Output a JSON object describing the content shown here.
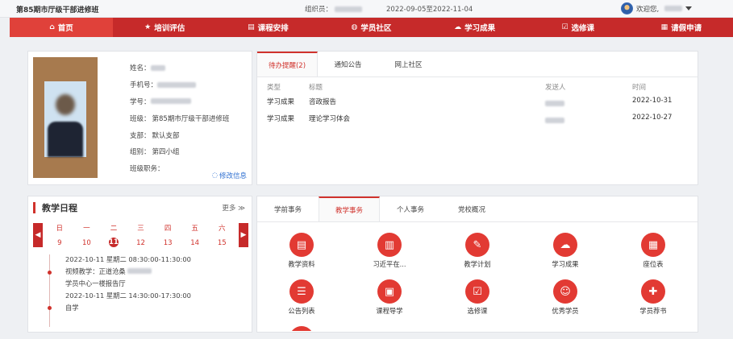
{
  "topbar": {
    "class_title": "第85期市厅级干部进修班",
    "organizer_label": "组织员：",
    "date_range": "2022-09-05至2022-11-04",
    "welcome_label": "欢迎您,"
  },
  "nav": {
    "items": [
      {
        "label": "首页",
        "icon": "home-icon",
        "glyph": "⌂"
      },
      {
        "label": "培训评估",
        "icon": "star-icon",
        "glyph": "★"
      },
      {
        "label": "课程安排",
        "icon": "schedule-icon",
        "glyph": "▤"
      },
      {
        "label": "学员社区",
        "icon": "globe-icon",
        "glyph": "◍"
      },
      {
        "label": "学习成果",
        "icon": "cloud-upload-icon",
        "glyph": "☁"
      },
      {
        "label": "选修课",
        "icon": "checkbox-icon",
        "glyph": "☑"
      },
      {
        "label": "请假申请",
        "icon": "document-icon",
        "glyph": "▦"
      }
    ]
  },
  "profile": {
    "name_label": "姓名：",
    "phone_label": "手机号：",
    "student_id_label": "学号：",
    "class_label": "班级：",
    "class_value": "第85期市厅级干部进修班",
    "branch_label": "支部：",
    "branch_value": "默认支部",
    "group_label": "组别：",
    "group_value": "第四小组",
    "duty_label": "班级职务：",
    "edit_label": "修改信息"
  },
  "todo": {
    "tabs": [
      "待办提醒(2)",
      "通知公告",
      "网上社区"
    ],
    "columns": [
      "类型",
      "标题",
      "发送人",
      "时间"
    ],
    "rows": [
      {
        "type": "学习成果",
        "title": "咨政报告",
        "time": "2022-10-31"
      },
      {
        "type": "学习成果",
        "title": "理论学习体会",
        "time": "2022-10-27"
      }
    ]
  },
  "schedule": {
    "title": "教学日程",
    "more_label": "更多 ≫",
    "days": [
      {
        "w": "日",
        "d": "9"
      },
      {
        "w": "一",
        "d": "10"
      },
      {
        "w": "二",
        "d": "11"
      },
      {
        "w": "三",
        "d": "12"
      },
      {
        "w": "四",
        "d": "13"
      },
      {
        "w": "五",
        "d": "14"
      },
      {
        "w": "六",
        "d": "15"
      }
    ],
    "events": [
      {
        "time": "2022-10-11 星期二 08:30:00-11:30:00",
        "title": "视频教学：正道沧桑",
        "place": "学员中心一楼报告厅"
      },
      {
        "time": "2022-10-11 星期二 14:30:00-17:30:00",
        "title": "自学"
      }
    ]
  },
  "affairs": {
    "tabs": [
      "学前事务",
      "教学事务",
      "个人事务",
      "党校概况"
    ],
    "items": [
      {
        "label": "教学资料",
        "icon": "teaching-materials-icon",
        "glyph": "▤"
      },
      {
        "label": "习近平在...",
        "icon": "scroll-icon",
        "glyph": "▥"
      },
      {
        "label": "教学计划",
        "icon": "plan-edit-icon",
        "glyph": "✎"
      },
      {
        "label": "学习成果",
        "icon": "cloud-upload-icon",
        "glyph": "☁"
      },
      {
        "label": "座位表",
        "icon": "seat-chart-icon",
        "glyph": "▦"
      },
      {
        "label": "公告列表",
        "icon": "list-icon",
        "glyph": "☰"
      },
      {
        "label": "课程导学",
        "icon": "course-guide-icon",
        "glyph": "▣"
      },
      {
        "label": "选修课",
        "icon": "checkbox-icon",
        "glyph": "☑"
      },
      {
        "label": "优秀学员",
        "icon": "person-icon",
        "glyph": "☺"
      },
      {
        "label": "学员荐书",
        "icon": "book-add-icon",
        "glyph": "✚"
      }
    ]
  }
}
